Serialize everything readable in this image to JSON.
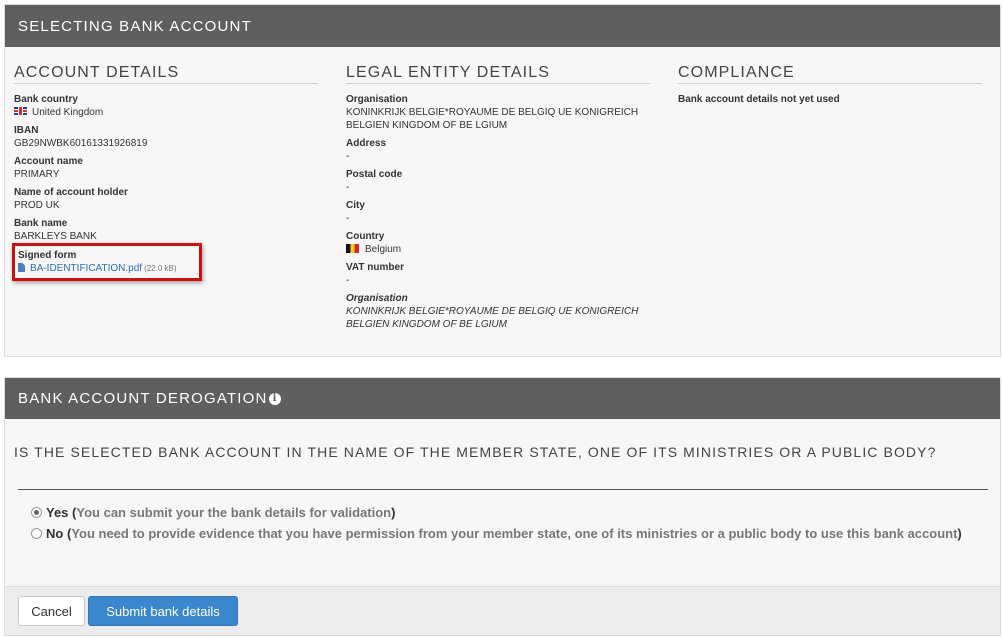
{
  "top_panel": {
    "title": "SELECTING BANK ACCOUNT",
    "account_details": {
      "heading": "ACCOUNT DETAILS",
      "bank_country_label": "Bank country",
      "bank_country_value": "United Kingdom",
      "iban_label": "IBAN",
      "iban_value": "GB29NWBK60161331926819",
      "account_name_label": "Account name",
      "account_name_value": "PRIMARY",
      "holder_label": "Name of account holder",
      "holder_value": "PROD UK",
      "bank_name_label": "Bank name",
      "bank_name_value": "BARKLEYS BANK",
      "signed_form_label": "Signed form",
      "signed_form_file": "BA-IDENTIFICATION.pdf",
      "signed_form_size": "(22.0 kB)"
    },
    "legal_entity": {
      "heading": "LEGAL ENTITY DETAILS",
      "organisation_label": "Organisation",
      "organisation_value_1": "KONINKRIJK BELGIE*ROYAUME DE BELGIQ UE KONIGREICH",
      "organisation_value_2": "BELGIEN KINGDOM OF BE LGIUM",
      "address_label": "Address",
      "address_value": "-",
      "postal_label": "Postal code",
      "postal_value": "-",
      "city_label": "City",
      "city_value": "-",
      "country_label": "Country",
      "country_value": "Belgium",
      "vat_label": "VAT number",
      "vat_value": "-",
      "organisation2_label": "Organisation",
      "organisation2_value_1": "KONINKRIJK BELGIE*ROYAUME DE BELGIQ UE KONIGREICH",
      "organisation2_value_2": "BELGIEN KINGDOM OF BE LGIUM"
    },
    "compliance": {
      "heading": "COMPLIANCE",
      "status": "Bank account details not yet used"
    }
  },
  "bottom_panel": {
    "title": "BANK ACCOUNT DEROGATION",
    "question": "IS THE SELECTED BANK ACCOUNT IN THE NAME OF THE MEMBER STATE, ONE OF ITS MINISTRIES OR A PUBLIC BODY?",
    "options": [
      {
        "label": "Yes",
        "hint_open": "(",
        "hint": "You can submit your the bank details for validation",
        "hint_close": ")",
        "selected": true
      },
      {
        "label": "No",
        "hint_open": "(",
        "hint": "You need to provide evidence that you have permission from your member state, one of its ministries or a public body to use this bank account",
        "hint_close": ")",
        "selected": false
      }
    ]
  },
  "footer": {
    "cancel_label": "Cancel",
    "submit_label": "Submit bank details"
  },
  "colors": {
    "header_bg": "#5f5f5f",
    "panel_bg": "#f7f7f7",
    "link": "#2a6db5",
    "primary_button": "#3a87cd",
    "highlight_border": "#cc1111"
  }
}
